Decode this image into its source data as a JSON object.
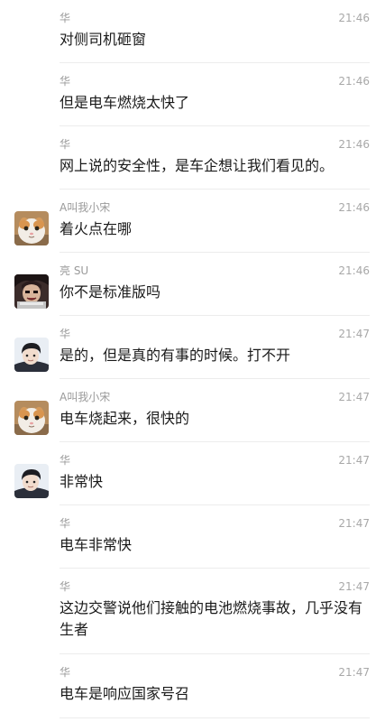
{
  "messages": [
    {
      "sender": "华",
      "time": "21:46",
      "text": "对侧司机砸窗",
      "avatar": "none"
    },
    {
      "sender": "华",
      "time": "21:46",
      "text": "但是电车燃烧太快了",
      "avatar": "none"
    },
    {
      "sender": "华",
      "time": "21:46",
      "text": "网上说的安全性，是车企想让我们看见的。",
      "avatar": "none"
    },
    {
      "sender": "A叫我小宋",
      "time": "21:46",
      "text": "着火点在哪",
      "avatar": "cat"
    },
    {
      "sender": "亮 SU",
      "time": "21:46",
      "text": "你不是标准版吗",
      "avatar": "figure"
    },
    {
      "sender": "华",
      "time": "21:47",
      "text": "是的，但是真的有事的时候。打不开",
      "avatar": "person"
    },
    {
      "sender": "A叫我小宋",
      "time": "21:47",
      "text": "电车烧起来，很快的",
      "avatar": "cat"
    },
    {
      "sender": "华",
      "time": "21:47",
      "text": "非常快",
      "avatar": "person"
    },
    {
      "sender": "华",
      "time": "21:47",
      "text": "电车非常快",
      "avatar": "none"
    },
    {
      "sender": "华",
      "time": "21:47",
      "text": "这边交警说他们接触的电池燃烧事故，几乎没有生者",
      "avatar": "none"
    },
    {
      "sender": "华",
      "time": "21:47",
      "text": "电车是响应国家号召",
      "avatar": "none"
    }
  ]
}
